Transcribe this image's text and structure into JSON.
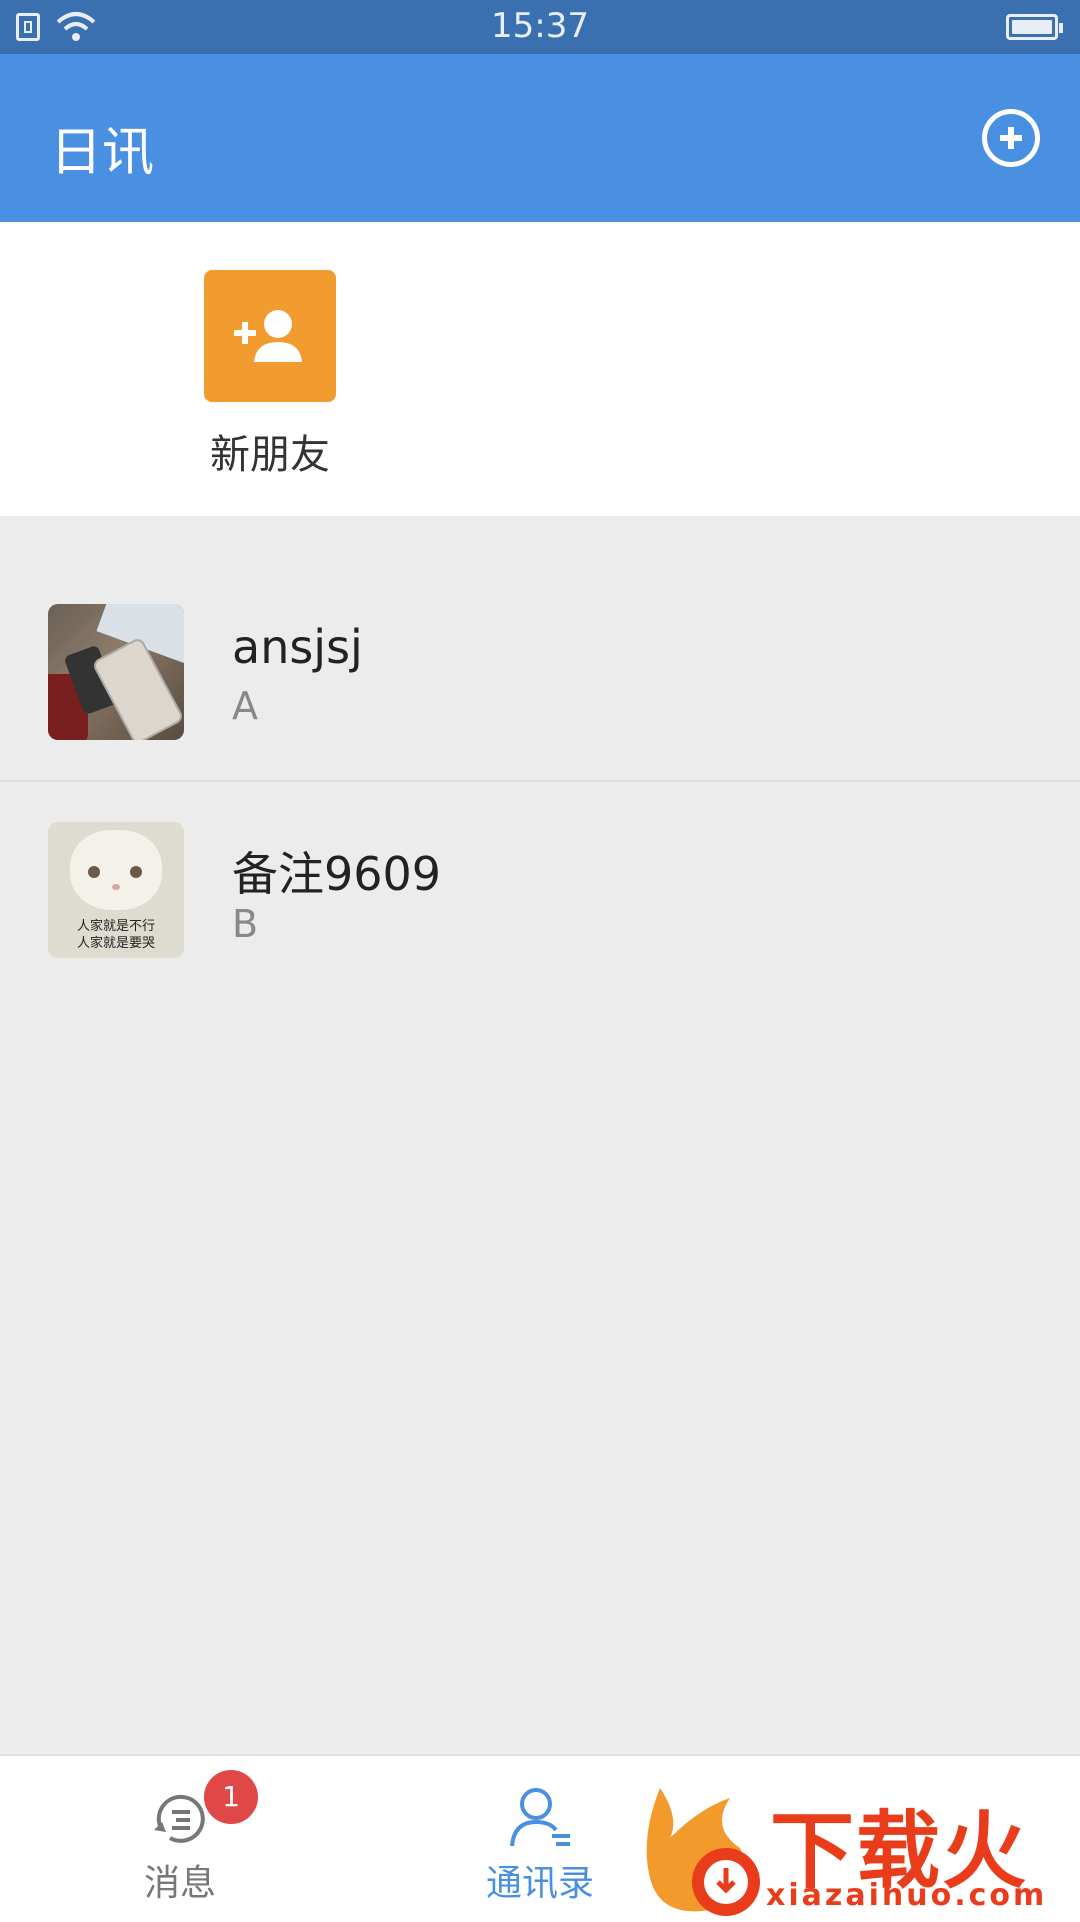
{
  "status_bar": {
    "time": "15:37"
  },
  "app_bar": {
    "title": "日讯",
    "add_icon": "plus-circle-icon"
  },
  "new_friends": {
    "label": "新朋友",
    "icon": "add-user-icon",
    "color": "#f29b2f"
  },
  "contacts": [
    {
      "name": "ansjsj",
      "index": "A",
      "avatar": "phone-photo"
    },
    {
      "name": "备注9609",
      "index": "B",
      "avatar": "cat-photo",
      "avatar_text": [
        "人家就是不行",
        "人家就是要哭"
      ]
    }
  ],
  "bottom_nav": {
    "items": [
      {
        "label": "消息",
        "icon": "message-icon",
        "badge": "1",
        "active": false
      },
      {
        "label": "通讯录",
        "icon": "contacts-icon",
        "active": true
      }
    ]
  },
  "watermark": {
    "text": "下载火",
    "sub": "xiazaihuo.com"
  },
  "colors": {
    "primary": "#4a90e2",
    "status_bar": "#3a6fb0",
    "accent": "#f29b2f",
    "badge": "#e04848"
  }
}
